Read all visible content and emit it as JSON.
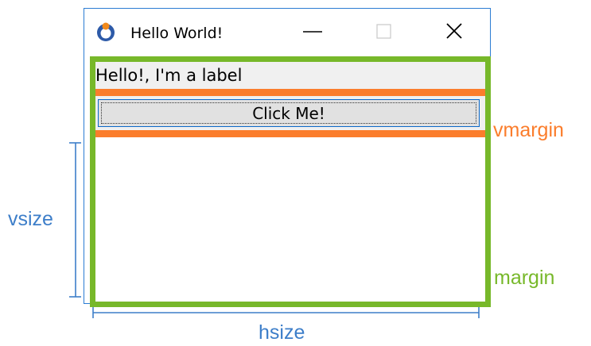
{
  "window": {
    "title": "Hello World!",
    "controls": {
      "minimize": "minimize",
      "maximize": "maximize",
      "close": "close"
    }
  },
  "client": {
    "label_text": "Hello!, I'm a label",
    "button_label": "Click Me!"
  },
  "annotations": {
    "vmargin": "vmargin",
    "margin": "margin",
    "vsize": "vsize",
    "hsize": "hsize"
  },
  "colors": {
    "window_border": "#2b7cd3",
    "margin_green": "#77b82a",
    "vmargin_orange": "#fb7d2c",
    "dimension_blue": "#3d7ec9"
  },
  "icons": [
    "app-icon",
    "minimize-icon",
    "maximize-icon",
    "close-icon"
  ]
}
